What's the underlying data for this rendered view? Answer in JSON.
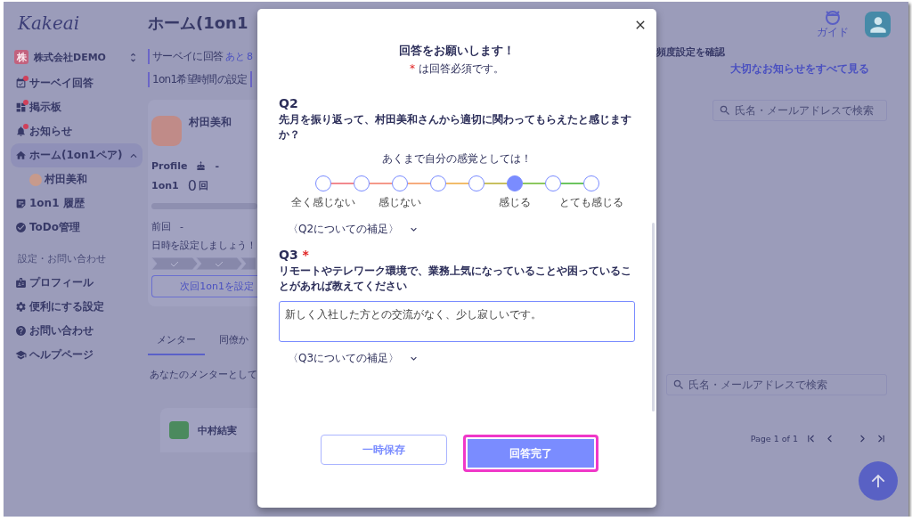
{
  "sidebar": {
    "logo": "Kakeai",
    "org": {
      "badge": "株",
      "name": "株式会社DEMO"
    },
    "items": [
      {
        "label": "サーベイ回答",
        "notification": true,
        "selected": false
      },
      {
        "label": "掲示板",
        "notification": true,
        "selected": false
      },
      {
        "label": "お知らせ",
        "notification": true,
        "selected": false
      },
      {
        "label": "ホーム(1on1ペア)",
        "notification": false,
        "selected": true,
        "expanded": true,
        "children": [
          {
            "label": "村田美和",
            "selected": false
          }
        ]
      },
      {
        "label": "1on1 履歴",
        "notification": false,
        "selected": false
      },
      {
        "label": "ToDo管理",
        "notification": false,
        "selected": false
      }
    ],
    "section_title": "設定・お問い合わせ",
    "settings_items": [
      {
        "label": "プロフィール",
        "selected": false
      },
      {
        "label": "便利にする設定",
        "selected": false
      },
      {
        "label": "お問い合わせ",
        "selected": false
      },
      {
        "label": "ヘルプページ",
        "selected": false
      }
    ]
  },
  "main": {
    "title": "ホーム(1on1",
    "notices": [
      {
        "label": "サーベイに回答",
        "extra": "あと 8"
      },
      {
        "label": "1on1希望時間の設定"
      }
    ],
    "notice_right": "頻度設定を確認",
    "announcements_link": "大切なお知らせをすべて見る",
    "guide_label": "ガイド",
    "pair_card": {
      "name": "村田美和",
      "profile_label": "Profile",
      "profile_value": "-",
      "count_label": "1on1",
      "count": "0",
      "count_unit": "回",
      "level": 0,
      "last_label": "前回",
      "last_value": "-",
      "hint": "日時を設定しましょう！",
      "button": "次回1on1を設定"
    },
    "search_placeholder_top": "氏名・メールアドレスで検索",
    "tabs": [
      {
        "label": "メンター",
        "selected": true
      },
      {
        "label": "同僚か",
        "selected": false
      }
    ],
    "tab_text": "あなたのメンターとして",
    "search_placeholder_bottom": "氏名・メールアドレスで検索",
    "pagination": "Page 1 of 1",
    "mentor_card": {
      "name": "中村結実"
    }
  },
  "modal": {
    "title": "回答をお願いします！",
    "note_mark": "*",
    "note": "は回答必須です。",
    "questions": [
      {
        "kind": "scale",
        "number": "Q2",
        "text": "先月を振り返って、村田美和さんから適切に関わってもらえたと感じますか？",
        "caption": "あくまで自分の感覚としては！",
        "options": [
          {
            "label": "全く感じない",
            "selected": false
          },
          {
            "selected": false
          },
          {
            "label": "感じない",
            "selected": false
          },
          {
            "selected": false
          },
          {
            "selected": false
          },
          {
            "label": "感じる",
            "selected": true
          },
          {
            "selected": false
          },
          {
            "label": "とても感じる",
            "selected": false
          }
        ],
        "supplement": "〈Q2についての補足〉"
      },
      {
        "kind": "text",
        "number": "Q3",
        "required_mark": "*",
        "text": "リモートやテレワーク環境で、業務上気になっていることや困っていることがあれば教えてください",
        "value": "新しく入社した方との交流がなく、少し寂しいです。",
        "supplement": "〈Q3についての補足〉"
      }
    ],
    "buttons": [
      {
        "label": "一時保存",
        "kind": "secondary"
      },
      {
        "label": "回答完了",
        "kind": "primary",
        "highlighted": true
      }
    ]
  }
}
